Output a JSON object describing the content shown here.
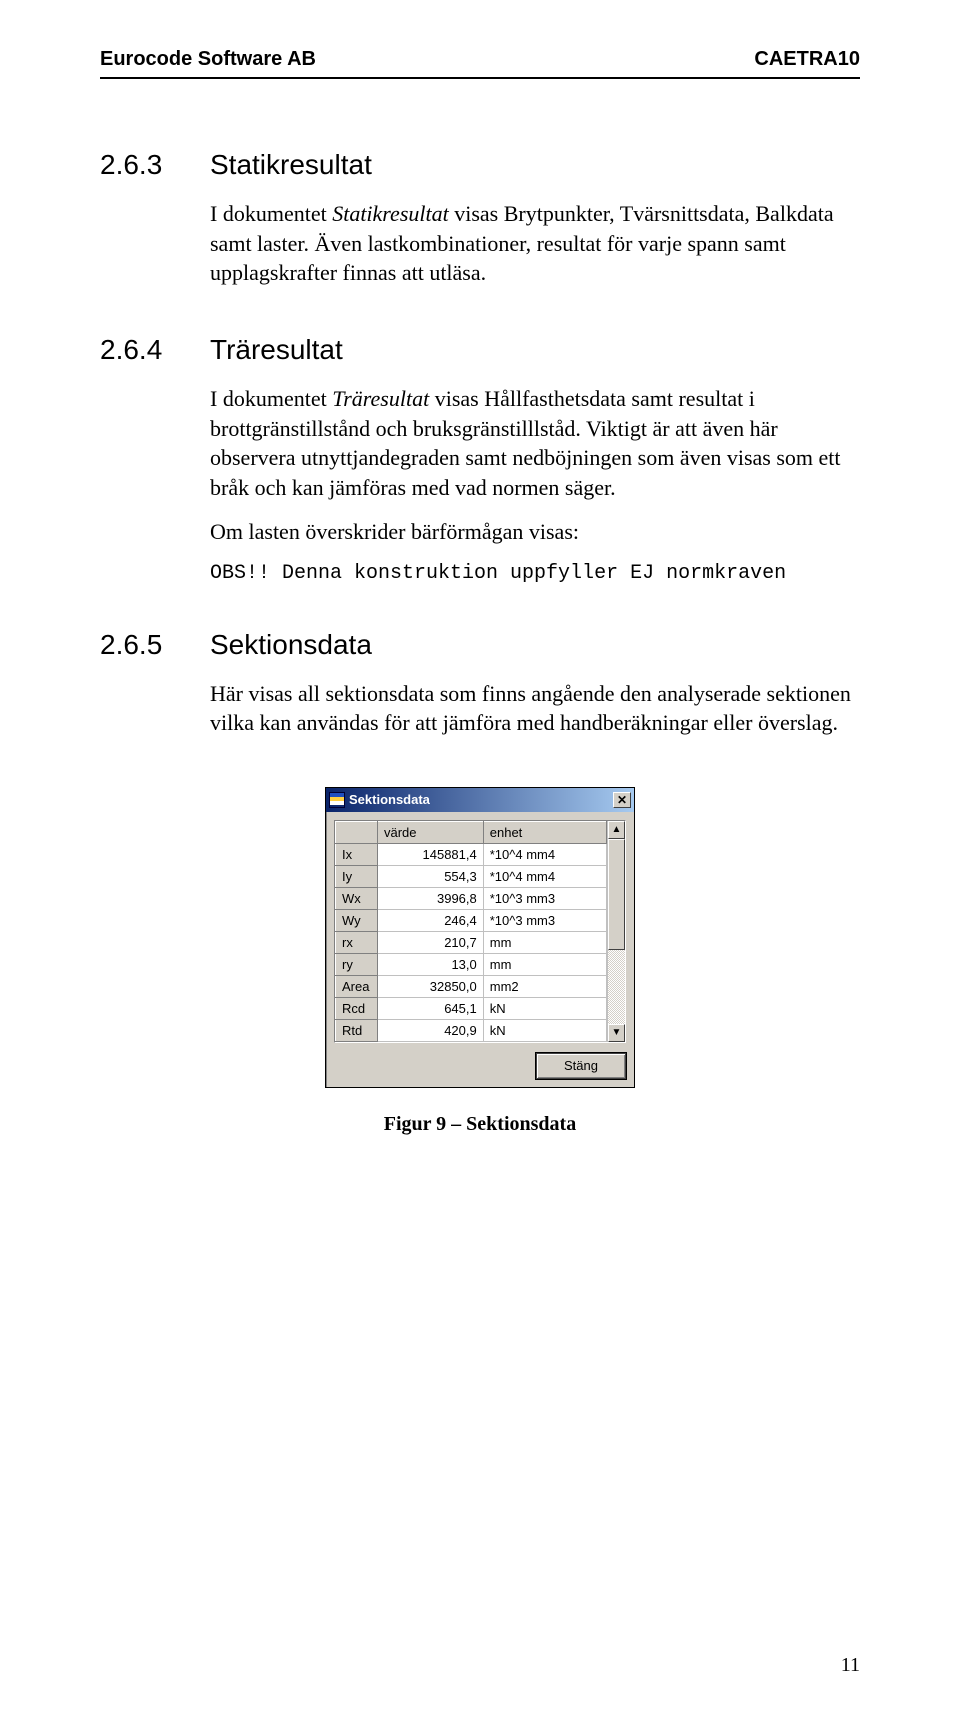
{
  "header": {
    "left": "Eurocode Software AB",
    "right": "CAETRA10"
  },
  "sections": [
    {
      "num": "2.6.3",
      "title": "Statikresultat",
      "paras": [
        {
          "html": "I dokumentet <i>Statikresultat</i> visas Brytpunkter, Tvärsnittsdata, Balkdata samt laster. Även lastkombinationer, resultat för varje spann samt upplagskrafter finnas att utläsa."
        }
      ]
    },
    {
      "num": "2.6.4",
      "title": "Träresultat",
      "paras": [
        {
          "html": "I dokumentet <i>Träresultat</i> visas Hållfasthetsdata samt resultat i brottgränstillstånd och bruksgränstilllståd. Viktigt är att även här observera utnyttjandegraden samt nedböjningen som även visas som ett bråk och kan jämföras med vad normen säger."
        },
        {
          "html": "Om lasten överskrider bärförmågan visas:"
        }
      ],
      "mono": "OBS!! Denna konstruktion uppfyller EJ normkraven"
    },
    {
      "num": "2.6.5",
      "title": "Sektionsdata",
      "paras": [
        {
          "html": "Här visas all sektionsdata som finns angående den analyserade sektionen vilka kan användas för att jämföra med handberäkningar eller överslag."
        }
      ]
    }
  ],
  "dialog": {
    "title": "Sektionsdata",
    "close_glyph": "✕",
    "headers": {
      "col1": "värde",
      "col2": "enhet"
    },
    "rows": [
      {
        "name": "Ix",
        "value": "145881,4",
        "unit": "*10^4 mm4"
      },
      {
        "name": "Iy",
        "value": "554,3",
        "unit": "*10^4 mm4"
      },
      {
        "name": "Wx",
        "value": "3996,8",
        "unit": "*10^3 mm3"
      },
      {
        "name": "Wy",
        "value": "246,4",
        "unit": "*10^3 mm3"
      },
      {
        "name": "rx",
        "value": "210,7",
        "unit": "mm"
      },
      {
        "name": "ry",
        "value": "13,0",
        "unit": "mm"
      },
      {
        "name": "Area",
        "value": "32850,0",
        "unit": "mm2"
      },
      {
        "name": "Rcd",
        "value": "645,1",
        "unit": "kN"
      },
      {
        "name": "Rtd",
        "value": "420,9",
        "unit": "kN"
      }
    ],
    "scroll_up": "▲",
    "scroll_down": "▼",
    "button": "Stäng"
  },
  "figure_caption": "Figur 9 – Sektionsdata",
  "page_number": "11"
}
